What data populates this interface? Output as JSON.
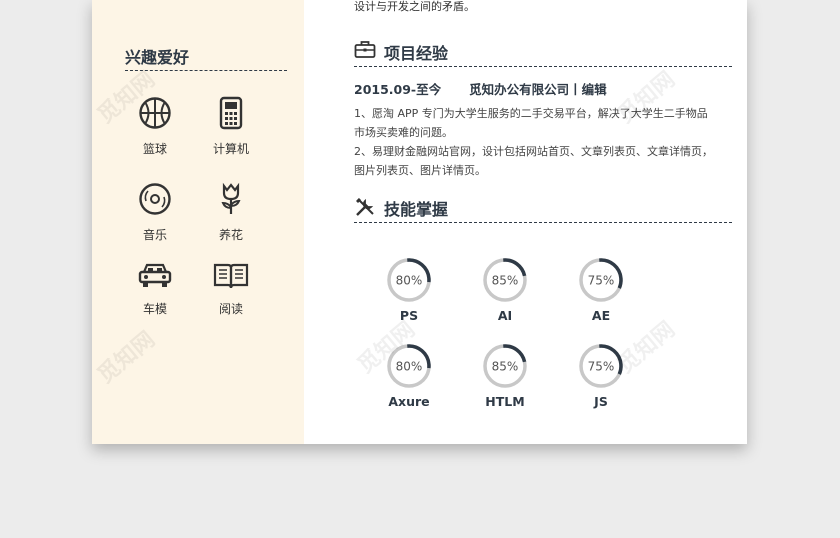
{
  "sidebar": {
    "title": "兴趣爱好",
    "hobbies": [
      {
        "label": "篮球",
        "icon": "basketball-icon"
      },
      {
        "label": "计算机",
        "icon": "calculator-icon"
      },
      {
        "label": "音乐",
        "icon": "music-disc-icon"
      },
      {
        "label": "养花",
        "icon": "flower-icon"
      },
      {
        "label": "车模",
        "icon": "car-icon"
      },
      {
        "label": "阅读",
        "icon": "book-icon"
      }
    ]
  },
  "main": {
    "top_text": "设计与开发之间的矛盾。",
    "project": {
      "title": "项目经验",
      "icon": "briefcase-icon",
      "period": "2015.09-至今",
      "company": "觅知办公有限公司丨编辑",
      "lines": [
        "1、愿淘 APP 专门为大学生服务的二手交易平台，解决了大学生二手物品",
        "市场买卖难的问题。",
        "2、易理财金融网站官网，设计包括网站首页、文章列表页、文章详情页，",
        "图片列表页、图片详情页。"
      ]
    },
    "skills": {
      "title": "技能掌握",
      "icon": "tools-icon",
      "items": [
        {
          "name": "PS",
          "percent": 80,
          "label": "80%"
        },
        {
          "name": "AI",
          "percent": 85,
          "label": "85%"
        },
        {
          "name": "AE",
          "percent": 75,
          "label": "75%"
        },
        {
          "name": "Axure",
          "percent": 80,
          "label": "80%"
        },
        {
          "name": "HTLM",
          "percent": 85,
          "label": "85%"
        },
        {
          "name": "JS",
          "percent": 75,
          "label": "75%"
        }
      ]
    }
  },
  "colors": {
    "accent": "#2f3a46",
    "sidebar_bg": "#fdf5e6",
    "ring_track": "#c8c8c8"
  }
}
